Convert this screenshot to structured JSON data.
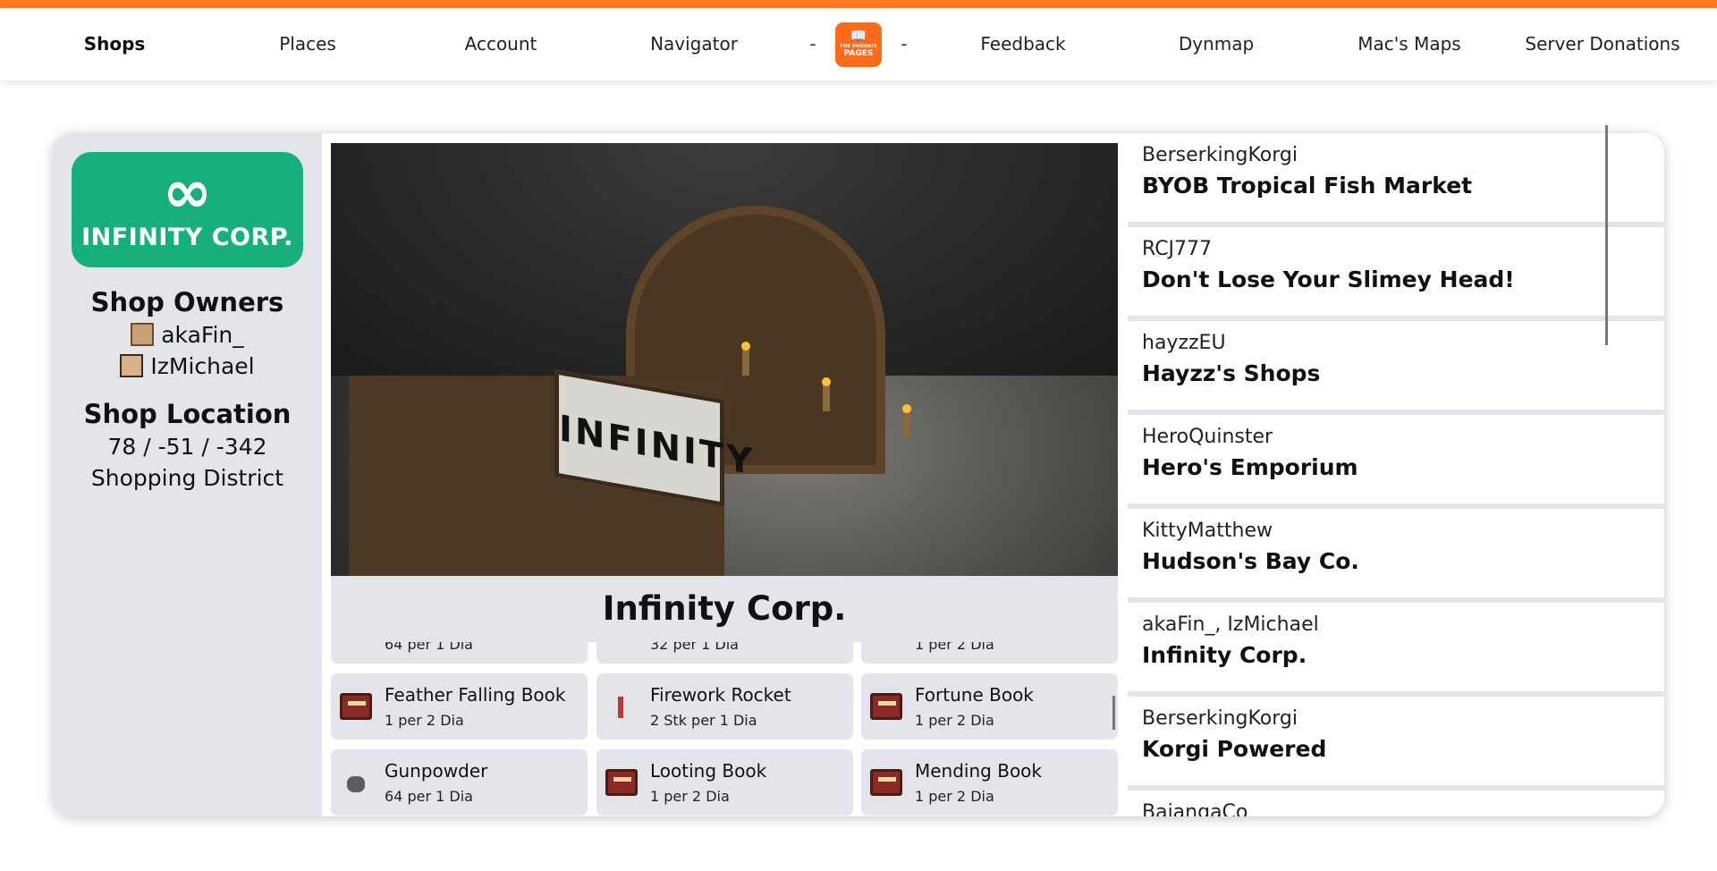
{
  "nav": {
    "items": [
      {
        "label": "Shops",
        "active": true
      },
      {
        "label": "Places"
      },
      {
        "label": "Account"
      },
      {
        "label": "Navigator"
      },
      {
        "label": "Feedback"
      },
      {
        "label": "Dynmap"
      },
      {
        "label": "Mac's Maps"
      },
      {
        "label": "Server Donations"
      }
    ],
    "separator": "-",
    "logo": {
      "line1": "THE PHOENIX",
      "line2": "PAGES"
    },
    "accent_color": "#ff7a21"
  },
  "shop": {
    "logo_text": "INFINITY CORP.",
    "logo_color": "#17b07d",
    "owners_heading": "Shop Owners",
    "owners": [
      "akaFin_",
      "IzMichael"
    ],
    "location_heading": "Shop Location",
    "coordinates": "78 / -51 / -342",
    "district": "Shopping District",
    "title": "Infinity Corp.",
    "image_sign_text": "INFINITY"
  },
  "items": [
    {
      "name": "",
      "price": "64 per 1 Dia",
      "icon": "item-icon"
    },
    {
      "name": "",
      "price": "32 per 1 Dia",
      "icon": "item-icon"
    },
    {
      "name": "",
      "price": "1 per 2 Dia",
      "icon": "item-icon"
    },
    {
      "name": "Feather Falling Book",
      "price": "1 per 2 Dia",
      "icon": "enchanted-book-icon"
    },
    {
      "name": "Firework Rocket",
      "price": "2 Stk per 1 Dia",
      "icon": "firework-rocket-icon"
    },
    {
      "name": "Fortune Book",
      "price": "1 per 2 Dia",
      "icon": "enchanted-book-icon"
    },
    {
      "name": "Gunpowder",
      "price": "64 per 1 Dia",
      "icon": "gunpowder-icon"
    },
    {
      "name": "Looting Book",
      "price": "1 per 2 Dia",
      "icon": "enchanted-book-icon"
    },
    {
      "name": "Mending Book",
      "price": "1 per 2 Dia",
      "icon": "enchanted-book-icon"
    }
  ],
  "shop_list": [
    {
      "owner": "BerserkingKorgi",
      "name": "BYOB Tropical Fish Market"
    },
    {
      "owner": "RCJ777",
      "name": "Don't Lose Your Slimey Head!"
    },
    {
      "owner": "hayzzEU",
      "name": "Hayzz's Shops"
    },
    {
      "owner": "HeroQuinster",
      "name": "Hero's Emporium"
    },
    {
      "owner": "KittyMatthew",
      "name": "Hudson's Bay Co."
    },
    {
      "owner": "akaFin_, IzMichael",
      "name": "Infinity Corp."
    },
    {
      "owner": "BerserkingKorgi",
      "name": "Korgi Powered"
    },
    {
      "owner": "BajangaCo",
      "name": ""
    }
  ]
}
